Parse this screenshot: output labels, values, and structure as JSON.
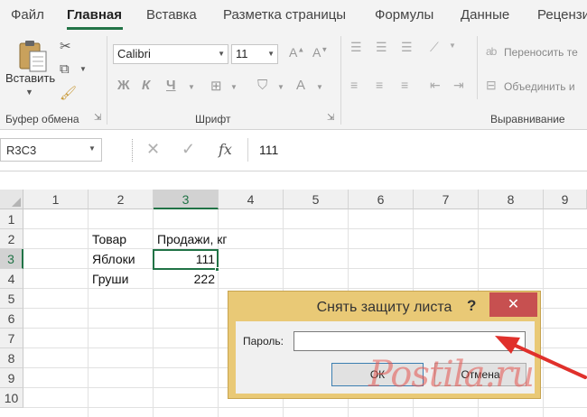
{
  "ribbon": {
    "tabs": [
      {
        "label": "Файл"
      },
      {
        "label": "Главная",
        "active": true
      },
      {
        "label": "Вставка"
      },
      {
        "label": "Разметка страницы"
      },
      {
        "label": "Формулы"
      },
      {
        "label": "Данные"
      },
      {
        "label": "Рецензи"
      }
    ],
    "clipboard": {
      "paste_label": "Вставить",
      "group_label": "Буфер обмена"
    },
    "font": {
      "name": "Calibri",
      "size": "11",
      "group_label": "Шрифт",
      "bold": "Ж",
      "italic": "К",
      "underline": "Ч"
    },
    "alignment": {
      "wrap_text": "Переносить те",
      "merge": "Объединить и",
      "group_label": "Выравнивание"
    }
  },
  "formula_bar": {
    "name_box": "R3C3",
    "formula": "111",
    "fx": "fx"
  },
  "grid": {
    "columns": [
      "1",
      "2",
      "3",
      "4",
      "5",
      "6",
      "7",
      "8",
      "9"
    ],
    "rows": [
      "1",
      "2",
      "3",
      "4",
      "5",
      "6",
      "7",
      "8",
      "9",
      "10"
    ],
    "cells": {
      "header_product": "Товар",
      "header_sales": "Продажи, кг",
      "row1_product": "Яблоки",
      "row1_sales": "111",
      "row2_product": "Груши",
      "row2_sales": "222"
    },
    "selected_column": "3",
    "selected_row": "3",
    "accent_color": "#217346"
  },
  "dialog": {
    "title": "Снять защиту листа",
    "help": "?",
    "close": "✕",
    "password_label": "Пароль:",
    "password_value": "",
    "ok_label": "ОК",
    "cancel_label": "Отмена"
  },
  "watermark": {
    "text": "Postila.ru"
  },
  "icons": [
    "paste-icon",
    "cut-icon",
    "copy-icon",
    "format-painter-icon",
    "borders-icon",
    "fill-color-icon",
    "font-color-icon",
    "cancel-icon",
    "enter-icon",
    "function-icon"
  ]
}
